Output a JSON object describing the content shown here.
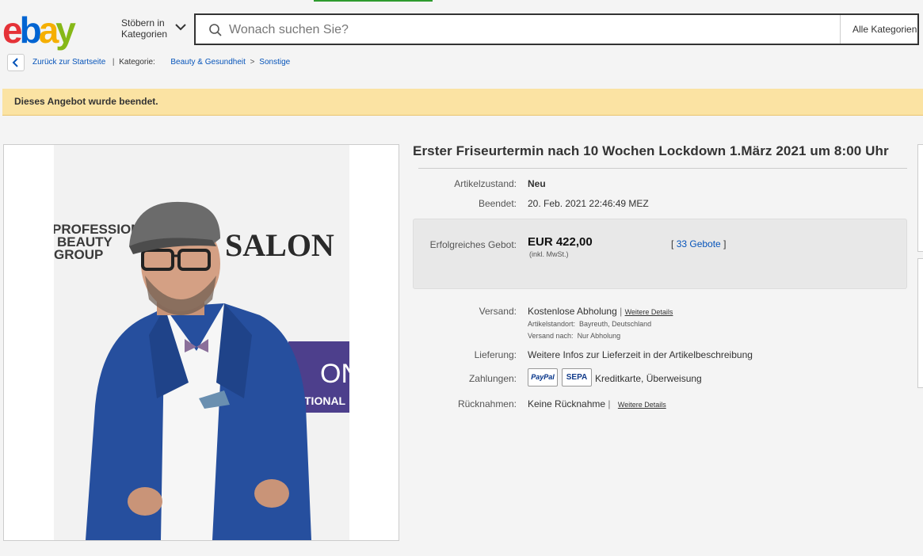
{
  "header": {
    "logo_text": "ebay",
    "browse_line1": "Stöbern in",
    "browse_line2": "Kategorien",
    "search_placeholder": "Wonach suchen Sie?",
    "category_select": "Alle Kategorien"
  },
  "breadcrumb": {
    "back_label": "Zurück zur Startseite",
    "category_label": "Kategorie:",
    "items": [
      "Beauty & Gesundheit",
      "Sonstige"
    ],
    "separator": ">"
  },
  "banner": {
    "text": "Dieses Angebot wurde beendet."
  },
  "photo": {
    "brand_left_top": "PROFESSIONAL",
    "brand_left_mid": "BEAUTY",
    "brand_left_bot": "GROUP",
    "brand_right": "SALON",
    "brand_panel_line1": "ON",
    "brand_panel_line2": "TIONAL"
  },
  "item": {
    "title": "Erster Friseurtermin nach 10 Wochen Lockdown 1.März 2021 um 8:00 Uhr",
    "condition_label": "Artikelzustand:",
    "condition_value": "Neu",
    "ended_label": "Beendet:",
    "ended_value": "20. Feb. 2021  22:46:49 MEZ",
    "bid_label": "Erfolgreiches Gebot:",
    "price": "EUR 422,00",
    "vat": "(inkl. MwSt.)",
    "bids_open": "[",
    "bids_count": "33 Gebote",
    "bids_close": "]",
    "shipping_label": "Versand:",
    "shipping_value": "Kostenlose Abholung",
    "shipping_sep": "|",
    "shipping_link": "Weitere Details",
    "location_label": "Artikelstandort:",
    "location_value": "Bayreuth, Deutschland",
    "ship_to_label": "Versand nach:",
    "ship_to_value": "Nur Abholung",
    "delivery_label": "Lieferung:",
    "delivery_value": "Weitere Infos zur Lieferzeit in der Artikelbeschreibung",
    "payment_label": "Zahlungen:",
    "payment_paypal": "PayPal",
    "payment_sepa": "SEPA",
    "payment_value": "Kreditkarte, Überweisung",
    "returns_label": "Rücknahmen:",
    "returns_value": "Keine Rücknahme",
    "returns_sep": "|",
    "returns_link": "Weitere Details"
  },
  "colors": {
    "ebay_e": "#e53238",
    "ebay_b": "#0064d2",
    "ebay_a": "#f5af02",
    "ebay_y": "#86b817",
    "banner_bg": "#fbe3a3",
    "link": "#0654ba"
  }
}
